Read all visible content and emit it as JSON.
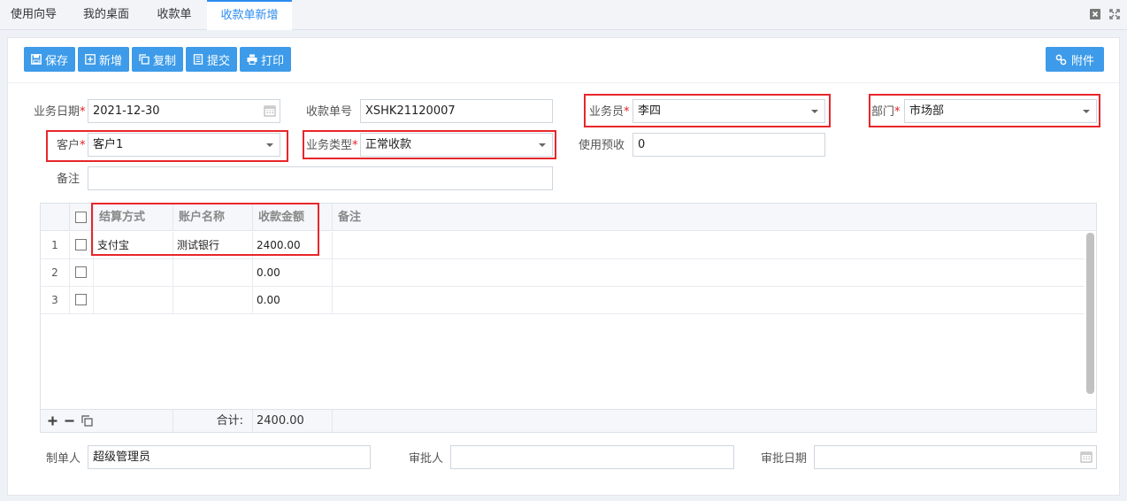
{
  "tabs": [
    {
      "label": "使用向导"
    },
    {
      "label": "我的桌面"
    },
    {
      "label": "收款单"
    },
    {
      "label": "收款单新增"
    }
  ],
  "toolbar": {
    "save": "保存",
    "add": "新增",
    "copy": "复制",
    "submit": "提交",
    "print": "打印",
    "attach": "附件"
  },
  "form": {
    "biz_date_label": "业务日期",
    "biz_date": "2021-12-30",
    "doc_no_label": "收款单号",
    "doc_no": "XSHK21120007",
    "salesman_label": "业务员",
    "salesman": "李四",
    "dept_label": "部门",
    "dept": "市场部",
    "customer_label": "客户",
    "customer": "客户1",
    "biz_type_label": "业务类型",
    "biz_type": "正常收款",
    "prepaid_label": "使用预收",
    "prepaid": "0",
    "remark_label": "备注",
    "remark": ""
  },
  "grid": {
    "headers": {
      "method": "结算方式",
      "account": "账户名称",
      "amount": "收款金额",
      "remark": "备注"
    },
    "rows": [
      {
        "num": "1",
        "method": "支付宝",
        "account": "测试银行",
        "amount": "2400.00",
        "remark": ""
      },
      {
        "num": "2",
        "method": "",
        "account": "",
        "amount": "0.00",
        "remark": ""
      },
      {
        "num": "3",
        "method": "",
        "account": "",
        "amount": "0.00",
        "remark": ""
      }
    ],
    "total_label": "合计:",
    "total": "2400.00"
  },
  "footer": {
    "maker_label": "制单人",
    "maker": "超级管理员",
    "approver_label": "审批人",
    "approver": "",
    "approve_date_label": "审批日期",
    "approve_date": ""
  },
  "colors": {
    "accent": "#2d8cf0",
    "button": "#3d9be9",
    "highlight": "#e8262a",
    "required": "#e02020"
  }
}
